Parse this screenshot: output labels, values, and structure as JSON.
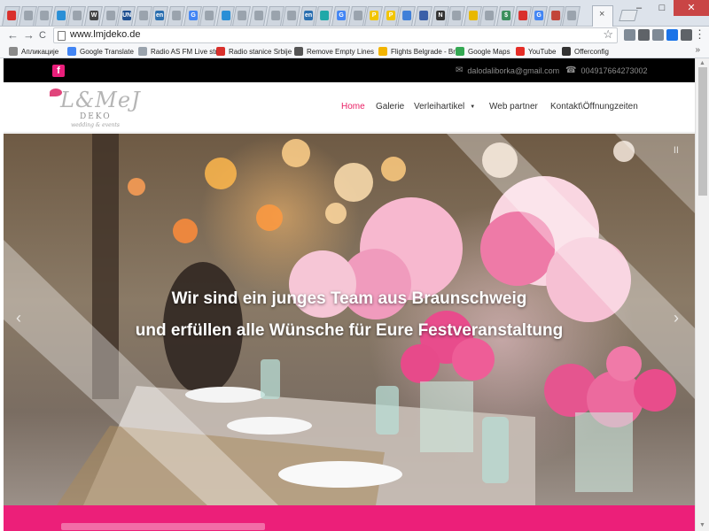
{
  "browser": {
    "tabs": [
      {
        "label": "",
        "color": "#d9302c"
      },
      {
        "label": "",
        "color": "#9aa3ad"
      },
      {
        "label": "",
        "color": "#9aa3ad"
      },
      {
        "label": "",
        "color": "#2a8fd6"
      },
      {
        "label": "",
        "color": "#9aa3ad"
      },
      {
        "label": "W",
        "color": "#444444"
      },
      {
        "label": "",
        "color": "#9aa3ad"
      },
      {
        "label": "UN",
        "color": "#1d4f91"
      },
      {
        "label": "",
        "color": "#9aa3ad"
      },
      {
        "label": "en",
        "color": "#2a6fb0"
      },
      {
        "label": "",
        "color": "#9aa3ad"
      },
      {
        "label": "G",
        "color": "#4285f4"
      },
      {
        "label": "",
        "color": "#9aa3ad"
      },
      {
        "label": "",
        "color": "#2a8fd6"
      },
      {
        "label": "",
        "color": "#9aa3ad"
      },
      {
        "label": "",
        "color": "#9aa3ad"
      },
      {
        "label": "",
        "color": "#9aa3ad"
      },
      {
        "label": "",
        "color": "#9aa3ad"
      },
      {
        "label": "en",
        "color": "#2a6fb0"
      },
      {
        "label": "",
        "color": "#1fa8a8"
      },
      {
        "label": "G",
        "color": "#4285f4"
      },
      {
        "label": "",
        "color": "#9aa3ad"
      },
      {
        "label": "P",
        "color": "#f2c500"
      },
      {
        "label": "P",
        "color": "#f2c500"
      },
      {
        "label": "",
        "color": "#3f7fd8"
      },
      {
        "label": "",
        "color": "#3a5fa8"
      },
      {
        "label": "N",
        "color": "#333333"
      },
      {
        "label": "",
        "color": "#9aa3ad"
      },
      {
        "label": "",
        "color": "#e8b800"
      },
      {
        "label": "",
        "color": "#9aa3ad"
      },
      {
        "label": "$",
        "color": "#3a8f5c"
      },
      {
        "label": "",
        "color": "#d9302c"
      },
      {
        "label": "G",
        "color": "#4285f4"
      },
      {
        "label": "",
        "color": "#c2453a"
      },
      {
        "label": "",
        "color": "#9aa3ad"
      }
    ],
    "active_tab_color": "#e0457b",
    "close_tab_glyph": "×",
    "window_buttons": [
      "–",
      "□",
      "✕"
    ],
    "nav": {
      "back": "←",
      "forward": "→",
      "reload": "C"
    },
    "url": "www.lmjdeko.de",
    "star": "☆",
    "extensions": [
      {
        "icon": "translate-icon",
        "color": "#7f8a96"
      },
      {
        "icon": "camera-icon",
        "color": "#5f6368"
      },
      {
        "icon": "document-icon",
        "color": "#7f8a96"
      },
      {
        "icon": "cast-icon",
        "color": "#1a73e8"
      },
      {
        "icon": "square-icon",
        "color": "#5f6368"
      }
    ],
    "menu": "⋮",
    "bookmarks": [
      {
        "label": "Апликације",
        "color": "#8a8a8a"
      },
      {
        "label": "Google Translate",
        "color": "#4285f4"
      },
      {
        "label": "Radio AS FM Live str",
        "color": "#9aa3ad"
      },
      {
        "label": "Radio stanice Srbije",
        "color": "#d9302c"
      },
      {
        "label": "Remove Empty Lines",
        "color": "#555555"
      },
      {
        "label": "Flights Belgrade - Br",
        "color": "#f2b400"
      },
      {
        "label": "Google Maps",
        "color": "#34a853"
      },
      {
        "label": "YouTube",
        "color": "#e52d27"
      },
      {
        "label": "Offerconfig",
        "color": "#333333"
      }
    ],
    "bookmarks_more": "»"
  },
  "site": {
    "topbar": {
      "facebook": "f",
      "email": "dalodaliborka@gmail.com",
      "phone": "004917664273002",
      "email_icon": "✉",
      "phone_icon": "☎"
    },
    "logo": {
      "text": "L&MeJ",
      "sub": "DEKO",
      "tagline": "wedding & events"
    },
    "nav": [
      {
        "label": "Home",
        "active": true
      },
      {
        "label": "Galerie"
      },
      {
        "label": "Verleihartikel",
        "caret": "▼"
      },
      {
        "label": "Web partner"
      },
      {
        "label": "Kontakt\\Öffnungzeiten"
      }
    ],
    "hero": {
      "line1": "Wir sind ein junges Team aus Braunschweig",
      "line2": "und erfüllen alle Wünsche für Eure Festveranstaltung",
      "prev": "‹",
      "next": "›",
      "pause": "II"
    },
    "brand_color": "#ec1f79"
  }
}
